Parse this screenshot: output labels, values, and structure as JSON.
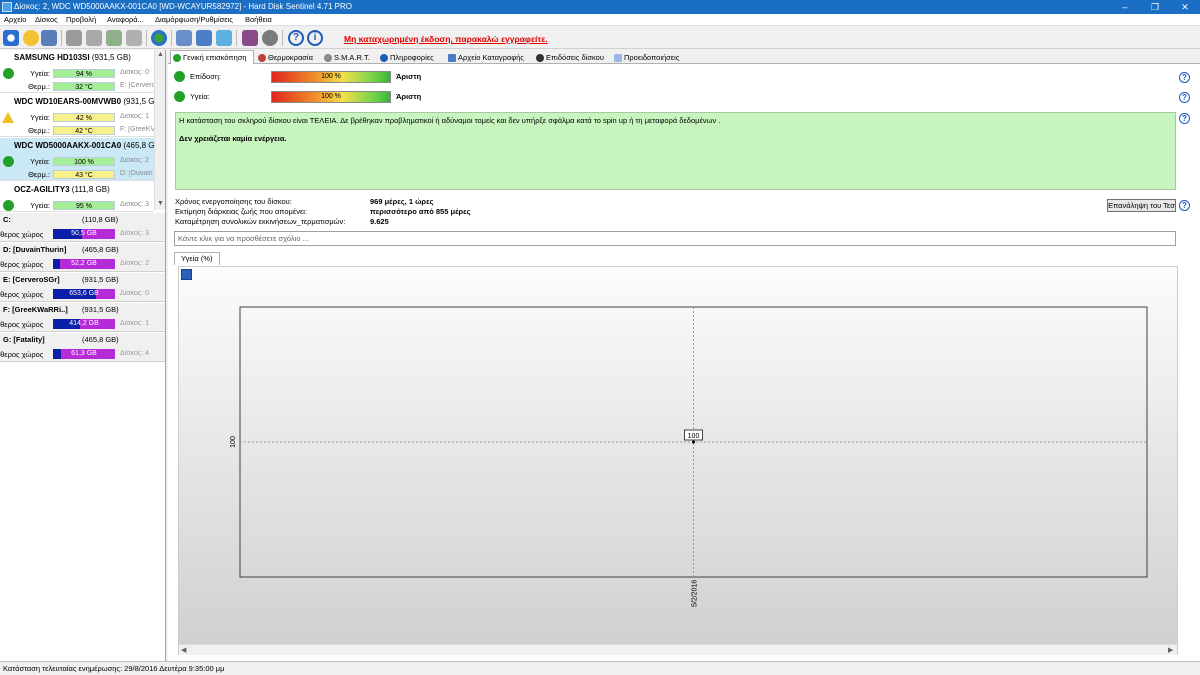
{
  "window": {
    "title": "Δίσκος: 2, WDC WD5000AAKX-001CA0 [WD-WCAYUR582972]  -  Hard Disk Sentinel 4.71 PRO"
  },
  "menu": [
    "Αρχείο",
    "Δίσκος",
    "Προβολή",
    "Αναφορά...",
    "Διαμόρφωση/Ρυθμίσεις",
    "Βοήθεια"
  ],
  "toolbar": {
    "register_text": "Μη καταχωρημένη έκδοση, παρακαλώ εγγραφείτε."
  },
  "disks": [
    {
      "name": "SAMSUNG HD103SI",
      "size": "(931,5 GB)",
      "health_label": "Υγεία:",
      "health": "94 %",
      "health_pct": 94,
      "temp_label": "Θερμ.:",
      "temp": "32 °C",
      "disk_ref": "Δίσκος: 0",
      "vol_ref": "E: [Cervero",
      "status": "ok"
    },
    {
      "name": "WDC WD10EARS-00MVWB0",
      "size": "(931,5 GB)",
      "health_label": "Υγεία:",
      "health": "42 %",
      "health_pct": 42,
      "temp_label": "Θερμ.:",
      "temp": "42 °C",
      "disk_ref": "Δίσκος: 1",
      "vol_ref": "F: [GreeKV",
      "status": "warning"
    },
    {
      "name": "WDC WD5000AAKX-001CA0",
      "size": "(465,8 GB)",
      "health_label": "Υγεία:",
      "health": "100 %",
      "health_pct": 100,
      "temp_label": "Θερμ.:",
      "temp": "43 °C",
      "disk_ref": "Δίσκος: 2",
      "vol_ref": "D: [Duvain",
      "status": "ok"
    },
    {
      "name": "OCZ-AGILITY3",
      "size": "(111,8 GB)",
      "health_label": "Υγεία:",
      "health": "95 %",
      "health_pct": 95,
      "disk_ref": "Δίσκος: 3",
      "status": "ok"
    }
  ],
  "volumes": [
    {
      "name": "C:",
      "size": "(110,8 GB)",
      "free_label": "ύθερος χώρος",
      "free": "50,5 GB",
      "free_ratio": 0.46,
      "disk_ref": "Δίσκος: 3"
    },
    {
      "name": "D: [DuvainThurin]",
      "size": "(465,8 GB)",
      "free_label": "ύθερος χώρος",
      "free": "52,2 GB",
      "free_ratio": 0.11,
      "disk_ref": "Δίσκος: 2"
    },
    {
      "name": "E: [CerveroSGr]",
      "size": "(931,5 GB)",
      "free_label": "ύθερος χώρος",
      "free": "653,6 GB",
      "free_ratio": 0.7,
      "disk_ref": "Δίσκος: 0"
    },
    {
      "name": "F: [GreeKWaRRi..]",
      "size": "(931,5 GB)",
      "free_label": "ύθερος χώρος",
      "free": "414,2 GB",
      "free_ratio": 0.44,
      "disk_ref": "Δίσκος: 1"
    },
    {
      "name": "G: [Fatality]",
      "size": "(465,8 GB)",
      "free_label": "ύθερος χώρος",
      "free": "61,3 GB",
      "free_ratio": 0.13,
      "disk_ref": "Δίσκος: 4"
    }
  ],
  "tabs": [
    "Γενική επισκόπηση",
    "Θερμοκρασία",
    "S.M.A.R.T.",
    "Πληροφορίες",
    "Αρχείο Καταγραφής",
    "Επιδόσεις δίσκου",
    "Προειδοποιήσεις"
  ],
  "overview": {
    "performance_label": "Επίδοση:",
    "performance_value": "100 %",
    "performance_rating": "Άριστη",
    "health_label": "Υγεία:",
    "health_value": "100 %",
    "health_rating": "Άριστη",
    "status_text": "Η κατάσταση του σκληρού δίσκου είναι ΤΕΛΕΙΑ. Δε βρέθηκαν προβληματικοί ή αδύναμοι τομείς και δεν υπήρξε σφάλμα κατά το spin up ή τη μεταφορά δεδομένων .",
    "action_text": "Δεν χρειάζεται καμία ενέργεια.",
    "uptime_label": "Χρόνος ενεργοποίησης του δίσκου:",
    "uptime_value": "969 μέρες, 1 ώρες",
    "lifetime_label": "Εκτίμηση διάρκειας ζωής που απομένει:",
    "lifetime_value": "περισσότερο από 855 μέρες",
    "starts_label": "Καταμέτρηση συνολικών εκκινήσεων_τερματισμών:",
    "starts_value": "9.625",
    "retest_button": "Επανάληψη του Τεσ",
    "comment_placeholder": "Κάντε κλικ για να προσθέσετε σχόλιο ...",
    "chart_tab": "Υγεία (%)"
  },
  "chart_data": {
    "type": "line",
    "x": [
      "5/2/2016"
    ],
    "values": [
      100
    ],
    "ytick_labels": [
      "100"
    ],
    "data_labels": [
      "100"
    ],
    "grid": true
  },
  "statusbar": {
    "text": "Κατάσταση τελευταίας ενημέρωσης: 29/8/2016 Δευτέρα 9:35:00 μμ"
  }
}
